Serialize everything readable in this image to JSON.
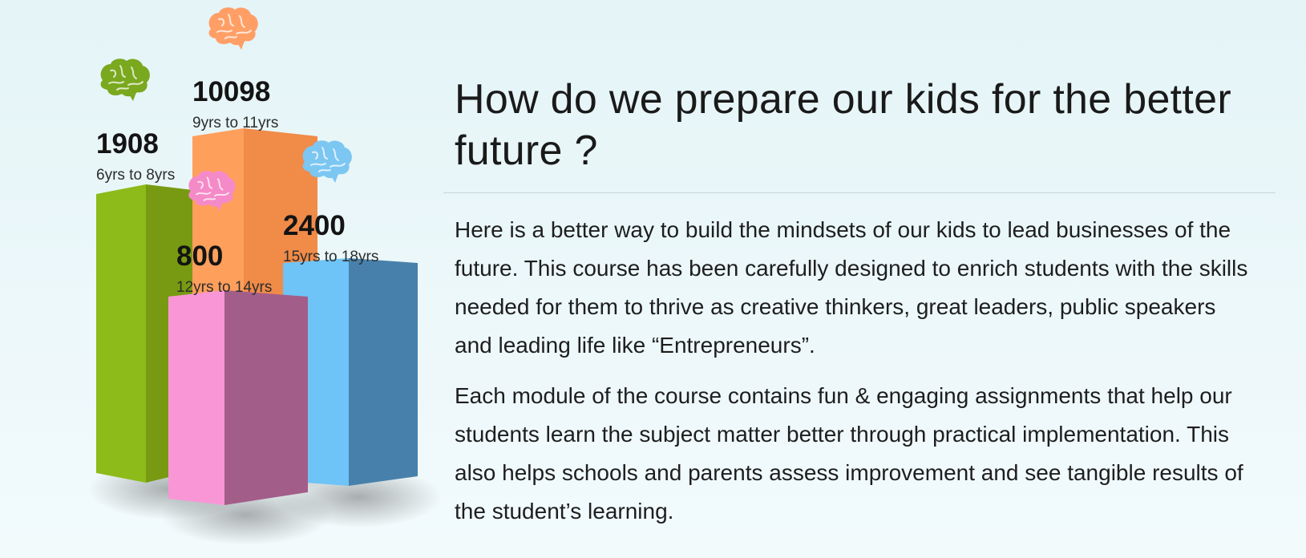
{
  "chart_data": {
    "type": "bar",
    "style": "3d-columns",
    "categories": [
      "6yrs to 8yrs",
      "9yrs to 11yrs",
      "12yrs to 14yrs",
      "15yrs to 18yrs"
    ],
    "series": [
      {
        "values": [
          1908,
          10098,
          800,
          2400
        ]
      }
    ],
    "value_labels": [
      "1908",
      "10098",
      "800",
      "2400"
    ],
    "title": "",
    "xlabel": "",
    "ylabel": "",
    "grid": false,
    "legend": "none",
    "colors": {
      "6yrs to 8yrs": {
        "front": "#8dbb1a",
        "side": "#789a12",
        "brain": "#7aa81e"
      },
      "9yrs to 11yrs": {
        "front": "#ff9f5c",
        "side": "#f08b48",
        "brain": "#ff9f66"
      },
      "12yrs to 14yrs": {
        "front": "#f996d6",
        "side": "#a35d89",
        "brain": "#f58ac8"
      },
      "15yrs to 18yrs": {
        "front": "#6ec3f7",
        "side": "#4781ab",
        "brain": "#7cc6f2"
      }
    }
  },
  "content": {
    "heading": "How do we prepare our kids for the better future ?",
    "paragraph_1": "Here is a better way to build the mindsets of our kids to lead businesses of the future. This course has been carefully designed to enrich students with the skills needed for them to thrive as creative thinkers, great leaders, public speakers and leading life like “Entrepreneurs”.",
    "paragraph_2": "Each module of the course contains fun & engaging assignments that help our students learn the subject matter better through practical implementation. This also helps schools and parents assess improvement and see tangible results of the student’s learning."
  }
}
